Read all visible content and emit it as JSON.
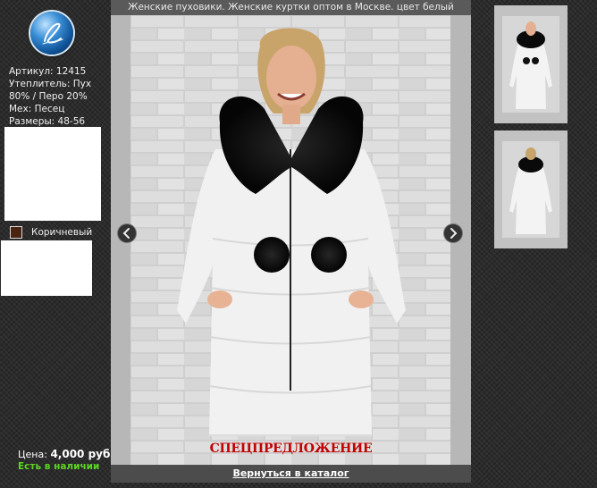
{
  "page": {
    "title": "Женские пуховики. Женские куртки оптом в Москве. цвет белый"
  },
  "logo": {
    "icon": "script-logo-icon"
  },
  "specs": {
    "article": "Артикул: 12415",
    "insulation_line1": "Утеплитель: Пух",
    "insulation_line2": "80% / Перо 20%",
    "fur": "Мех: Песец",
    "sizes": "Размеры: 48-56"
  },
  "color_option": {
    "label": "Коричневый",
    "swatch": "#4a2410"
  },
  "price": {
    "label": "Цена:",
    "value": "4,000 руб.",
    "availability": "Есть в наличии",
    "availability_color": "#5cd623"
  },
  "viewer": {
    "special_offer": "СПЕЦПРЕДЛОЖЕНИЕ",
    "back_link": "Вернуться в каталог",
    "prev_icon": "chevron-left-icon",
    "next_icon": "chevron-right-icon"
  },
  "thumbnails": [
    {
      "view": "front"
    },
    {
      "view": "back"
    }
  ]
}
